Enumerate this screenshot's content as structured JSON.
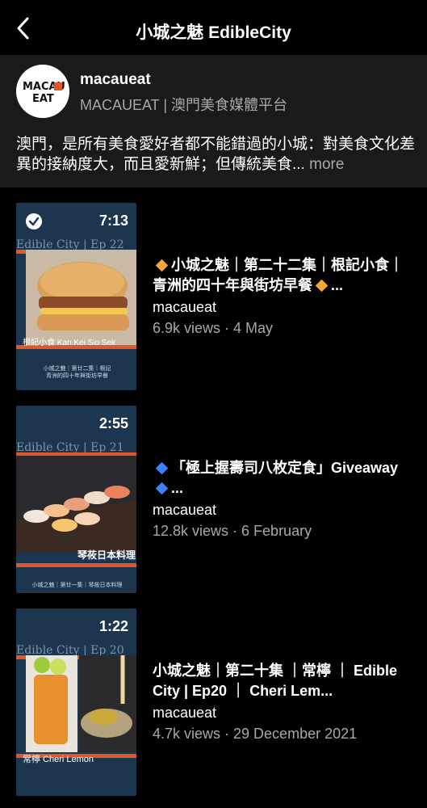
{
  "header": {
    "title": "小城之魅 EdibleCity",
    "back_icon": "chevron-left-icon"
  },
  "profile": {
    "avatar_text": "MACAU EAT",
    "name": "macaueat",
    "subtitle": "MACAUEAT | 澳門美食媒體平台",
    "description": "澳門，是所有美食愛好者都不能錯過的小城：對美食文化差異的接納度大，而且愛新鮮；但傳統美食...",
    "more_label": " more"
  },
  "videos": [
    {
      "duration": "7:13",
      "watched": true,
      "title_prefix_icon": "orange-diamond-icon",
      "title": "小城之魅｜第二十二集｜根記小食｜青洲的四十年與街坊早餐",
      "title_suffix": "...",
      "channel": "macaueat",
      "meta": "6.9k views · 4 May",
      "thumb_ep": "Edible City | Ep 22",
      "thumb_caption": "根記小食 Kan Kei Sio Sek",
      "thumb_small": "小城之魅｜第廿二集｜根記\n青洲的四十年與街坊早餐"
    },
    {
      "duration": "2:55",
      "watched": false,
      "title_prefix_icon": "blue-diamond-icon",
      "title": "「極上握壽司八枚定食」Giveaway",
      "title_suffix": "...",
      "channel": "macaueat",
      "meta": "12.8k views · 6 February",
      "thumb_ep": "Edible City | Ep 21",
      "thumb_caption": "琴莜日本料理",
      "thumb_small": "小城之魅｜第廿一集｜琴莜日本料理"
    },
    {
      "duration": "1:22",
      "watched": false,
      "title_prefix_icon": "",
      "title": "小城之魅｜第二十集 ｜常檸 ｜ Edible City | Ep20 ｜ Cheri Lem...",
      "title_suffix": "",
      "channel": "macaueat",
      "meta": "4.7k views · 29 December 2021",
      "thumb_ep": "Edible City | Ep 20",
      "thumb_caption": "常檸 Cheri Lemon",
      "thumb_small": ""
    }
  ],
  "colors": {
    "background": "#000000",
    "profile_bg": "#1a1a1a",
    "thumb_bg": "#1c3650",
    "accent_orange": "#e0572a",
    "muted_text": "#a8a8a8"
  }
}
